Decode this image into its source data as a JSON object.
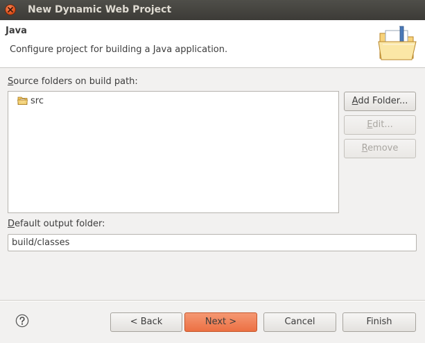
{
  "window": {
    "title": "New Dynamic Web Project"
  },
  "banner": {
    "title": "Java",
    "description": "Configure project for building a Java application.",
    "icon": "java-folder-wizard-icon"
  },
  "source_folders": {
    "label_mnemonic": "S",
    "label_rest": "ource folders on build path:",
    "items": [
      {
        "label": "src",
        "icon": "source-folder-icon"
      }
    ]
  },
  "side_buttons": {
    "add_folder_mnemonic": "A",
    "add_folder_rest": "dd Folder...",
    "edit_mnemonic": "E",
    "edit_rest": "dit...",
    "remove_mnemonic": "R",
    "remove_rest": "emove"
  },
  "output": {
    "label_mnemonic": "D",
    "label_rest": "efault output folder:",
    "value": "build/classes"
  },
  "footer": {
    "back_label": "< Back",
    "next_label": "Next >",
    "cancel_label": "Cancel",
    "finish_label": "Finish",
    "help_icon": "help-icon"
  }
}
